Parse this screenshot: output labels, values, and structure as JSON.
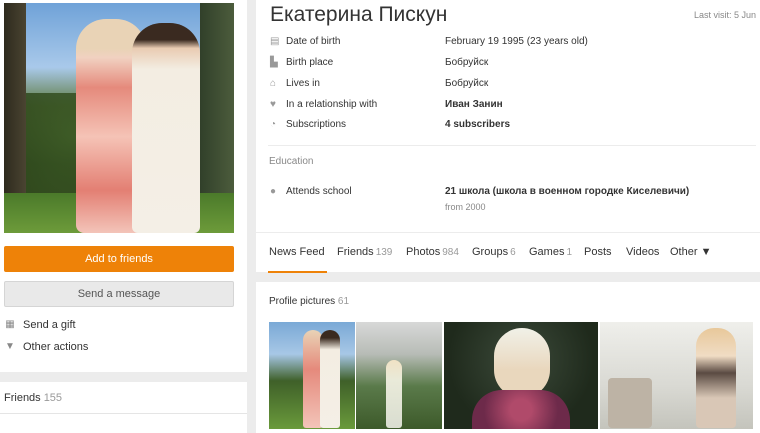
{
  "profile": {
    "name": "Екатерина Пискун",
    "last_visit": "Last visit: 5 Jun"
  },
  "actions": {
    "add_friends": "Add to friends",
    "send_message": "Send a message",
    "send_gift": "Send a gift",
    "other_actions": "Other actions"
  },
  "info": [
    {
      "icon": "calendar-icon",
      "label": "Date of birth",
      "value": "February 19 1995 (23 years old)"
    },
    {
      "icon": "birthplace-icon",
      "label": "Birth place",
      "value": "Бобруйск"
    },
    {
      "icon": "home-icon",
      "label": "Lives in",
      "value": "Бобруйск"
    },
    {
      "icon": "heart-icon",
      "label": "In a relationship with",
      "value": "Иван Занин"
    },
    {
      "icon": "rss-icon",
      "label": "Subscriptions",
      "value": "4 subscribers"
    }
  ],
  "education": {
    "heading": "Education",
    "label": "Attends school",
    "school": "21 школа (школа в военном городке Киселевичи)",
    "from": "from 2000"
  },
  "tabs": [
    {
      "label": "News Feed",
      "count": ""
    },
    {
      "label": "Friends",
      "count": "139"
    },
    {
      "label": "Photos",
      "count": "984"
    },
    {
      "label": "Groups",
      "count": "6"
    },
    {
      "label": "Games",
      "count": "1"
    },
    {
      "label": "Posts",
      "count": ""
    },
    {
      "label": "Videos",
      "count": ""
    },
    {
      "label": "Other ▼",
      "count": ""
    }
  ],
  "profile_pictures": {
    "label": "Profile pictures",
    "count": "61"
  },
  "friends_panel": {
    "label": "Friends",
    "count": "155"
  },
  "colors": {
    "accent": "#ee8208"
  }
}
